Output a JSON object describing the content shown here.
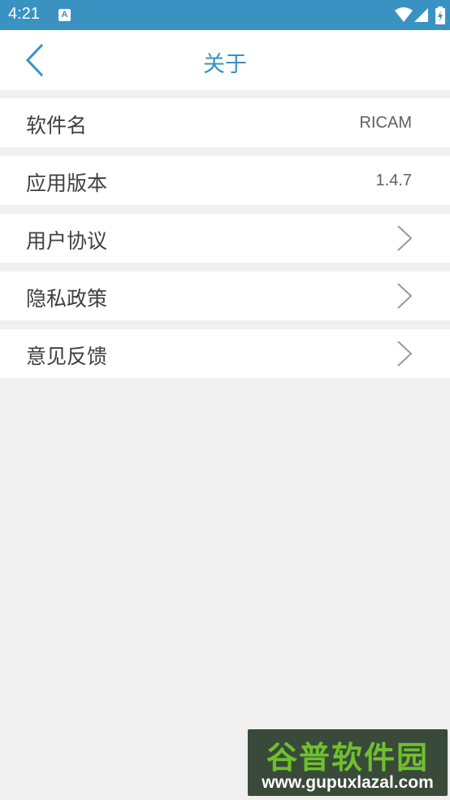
{
  "status_bar": {
    "time": "4:21",
    "notification_icon": "A",
    "icons": [
      "wifi-icon",
      "signal-icon",
      "battery-icon"
    ]
  },
  "header": {
    "title": "关于",
    "back_icon": "chevron-left-icon"
  },
  "rows": [
    {
      "label": "软件名",
      "value": "RICAM"
    },
    {
      "label": "应用版本",
      "value": "1.4.7"
    },
    {
      "label": "用户协议",
      "icon": "chevron-right-icon"
    },
    {
      "label": "隐私政策",
      "icon": "chevron-right-icon"
    },
    {
      "label": "意见反馈",
      "icon": "chevron-right-icon"
    }
  ],
  "watermark": {
    "title": "谷普软件园",
    "url": "www.gupuxlazal.com"
  },
  "colors": {
    "accent": "#3a92c3",
    "background": "#f0f0f0",
    "row_background": "#ffffff",
    "text": "#404040"
  }
}
